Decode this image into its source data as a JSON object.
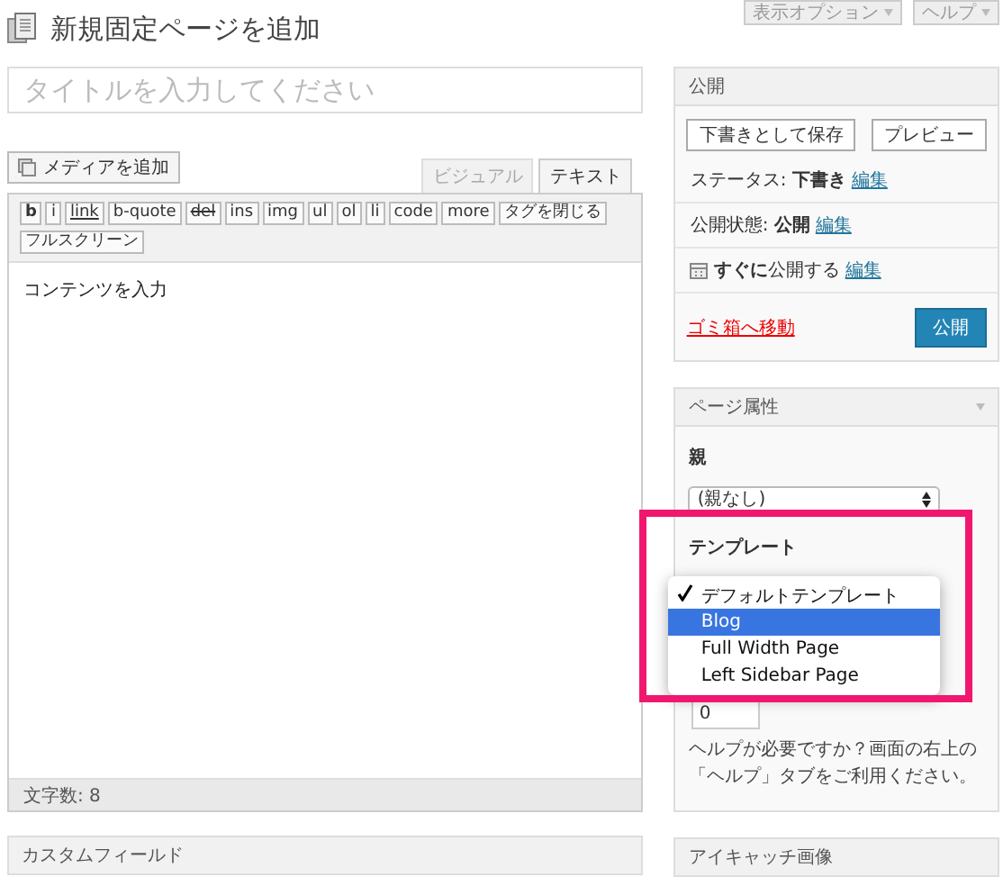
{
  "header": {
    "title": "新規固定ページを追加",
    "buttons": [
      "表示オプション",
      "ヘルプ"
    ]
  },
  "title_field": {
    "placeholder": "タイトルを入力してください"
  },
  "editor": {
    "media_button": "メディアを追加",
    "tabs": [
      {
        "label": "ビジュアル",
        "selected": false
      },
      {
        "label": "テキスト",
        "selected": true
      }
    ],
    "toolbar": [
      {
        "label": "b",
        "kind": "bold"
      },
      {
        "label": "i",
        "kind": "plain"
      },
      {
        "label": "link",
        "kind": "underline"
      },
      {
        "label": "b-quote",
        "kind": "plain"
      },
      {
        "label": "del",
        "kind": "strike"
      },
      {
        "label": "ins",
        "kind": "plain"
      },
      {
        "label": "img",
        "kind": "plain"
      },
      {
        "label": "ul",
        "kind": "plain"
      },
      {
        "label": "ol",
        "kind": "plain"
      },
      {
        "label": "li",
        "kind": "plain"
      },
      {
        "label": "code",
        "kind": "plain"
      },
      {
        "label": "more",
        "kind": "plain"
      },
      {
        "label": "タグを閉じる",
        "kind": "plain"
      },
      {
        "label": "フルスクリーン",
        "kind": "plain"
      }
    ],
    "content": "コンテンツを入力",
    "word_count": "文字数: 8"
  },
  "custom_fields": {
    "title": "カスタムフィールド"
  },
  "publish": {
    "title": "公開",
    "buttons": [
      "下書きとして保存",
      "プレビュー"
    ],
    "rows": [
      {
        "text": "ステータス: **下書き**",
        "link": "編集"
      },
      {
        "text": "公開状態: **公開**",
        "link": "編集"
      },
      {
        "text": "**すぐに**公開する",
        "link": "編集"
      }
    ],
    "trash": "ゴミ箱へ移動",
    "publish_button": "公開"
  },
  "page_attributes": {
    "title": "ページ属性",
    "parent_label": "親",
    "parent_value": "(親なし)",
    "template_label": "テンプレート",
    "template_options": [
      {
        "label": "デフォルトテンプレート",
        "checked": true,
        "selected": false
      },
      {
        "label": "Blog",
        "checked": false,
        "selected": true
      },
      {
        "label": "Full Width Page",
        "checked": false,
        "selected": false
      },
      {
        "label": "Left Sidebar Page",
        "checked": false,
        "selected": false
      }
    ],
    "order_value": "0",
    "help": "ヘルプが必要ですか？画面の右上の「ヘルプ」タブをご利用ください。"
  },
  "featured_image": {
    "title": "アイキャッチ画像"
  }
}
